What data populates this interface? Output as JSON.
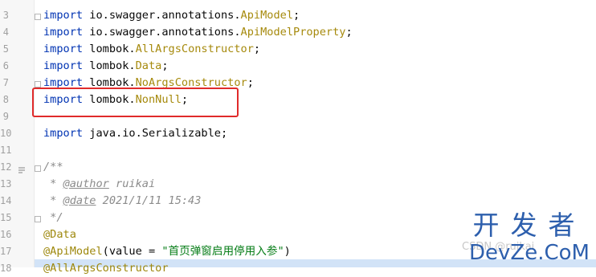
{
  "lines": [
    {
      "num": "3"
    },
    {
      "num": "4"
    },
    {
      "num": "5"
    },
    {
      "num": "6"
    },
    {
      "num": "7"
    },
    {
      "num": "8"
    },
    {
      "num": "9"
    },
    {
      "num": "10"
    },
    {
      "num": "11"
    },
    {
      "num": "12"
    },
    {
      "num": "13"
    },
    {
      "num": "14"
    },
    {
      "num": "15"
    },
    {
      "num": "16"
    },
    {
      "num": "17"
    },
    {
      "num": "18"
    }
  ],
  "code": {
    "l3": {
      "kw": "import",
      "pkg": " io.swagger.annotations.",
      "cls": "ApiModel",
      "end": ";"
    },
    "l4": {
      "kw": "import",
      "pkg": " io.swagger.annotations.",
      "cls": "ApiModelProperty",
      "end": ";"
    },
    "l5": {
      "kw": "import",
      "pkg": " lombok.",
      "cls": "AllArgsConstructor",
      "end": ";"
    },
    "l6": {
      "kw": "import",
      "pkg": " lombok.",
      "cls": "Data",
      "end": ";"
    },
    "l7": {
      "kw": "import",
      "pkg": " lombok.",
      "cls": "NoArgsConstructor",
      "end": ";"
    },
    "l8": {
      "kw": "import",
      "pkg": " lombok.",
      "cls": "NonNull",
      "end": ";"
    },
    "l10": {
      "kw": "import",
      "pkg": " java.io.Serializable;"
    },
    "l12": {
      "cmt": "/**"
    },
    "l13": {
      "pre": " * ",
      "tag": "@author",
      "val": " ruikai"
    },
    "l14": {
      "pre": " * ",
      "tag": "@date",
      "val": " 2021/1/11 15:43"
    },
    "l15": {
      "cmt": " */"
    },
    "l16": {
      "ann": "@Data"
    },
    "l17": {
      "ann": "@ApiModel",
      "open": "(value = ",
      "str": "\"首页弹窗启用停用入参\"",
      "close": ")"
    },
    "l18": {
      "ann": "@AllArgsConstructor"
    }
  },
  "watermark": {
    "cn": "开发者",
    "en": "DevZe.CoM",
    "csdn": "CSDN @ruikai"
  },
  "colors": {
    "keyword": "#0033b3",
    "class": "#a68a0d",
    "string": "#067d17",
    "comment": "#8c8c8c",
    "highlight_box": "#e02b2b",
    "watermark": "#2d5fad"
  }
}
